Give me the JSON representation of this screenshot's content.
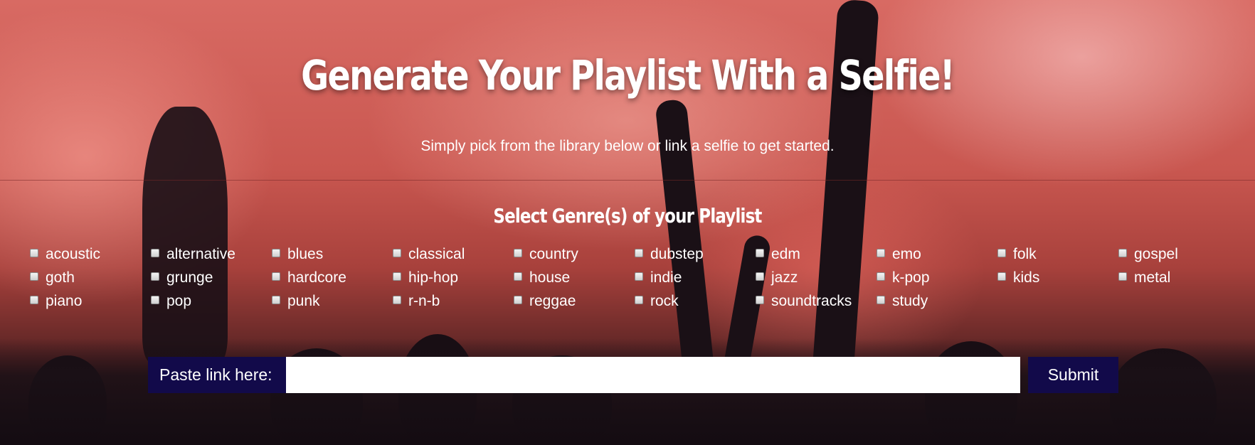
{
  "header": {
    "title": "Generate Your Playlist With a Selfie!",
    "subtitle": "Simply pick from the library below or link a selfie to get started."
  },
  "genres": {
    "heading": "Select Genre(s) of your Playlist",
    "items": [
      "acoustic",
      "alternative",
      "blues",
      "classical",
      "country",
      "dubstep",
      "edm",
      "emo",
      "folk",
      "gospel",
      "goth",
      "grunge",
      "hardcore",
      "hip-hop",
      "house",
      "indie",
      "jazz",
      "k-pop",
      "kids",
      "metal",
      "piano",
      "pop",
      "punk",
      "r-n-b",
      "reggae",
      "rock",
      "soundtracks",
      "study"
    ]
  },
  "link": {
    "label": "Paste link here:",
    "value": "",
    "submit_label": "Submit"
  },
  "colors": {
    "button_bg": "#120a4a",
    "text": "#ffffff"
  }
}
